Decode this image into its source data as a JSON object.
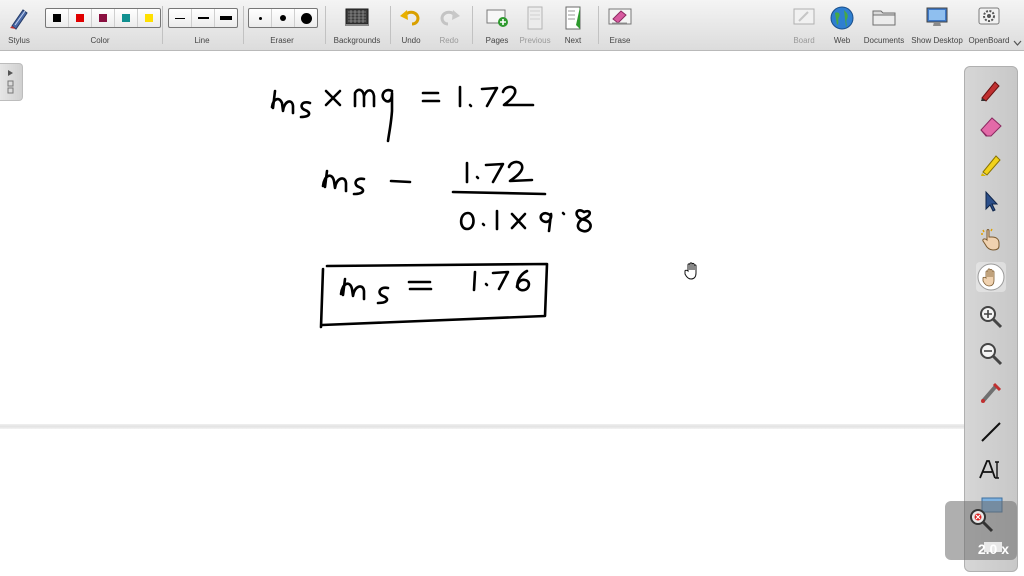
{
  "toolbar": {
    "stylus_label": "Stylus",
    "color_label": "Color",
    "colors": [
      "#000000",
      "#e00000",
      "#8a1040",
      "#119090",
      "#ffe000"
    ],
    "line_label": "Line",
    "eraser_label": "Eraser",
    "backgrounds_label": "Backgrounds",
    "undo_label": "Undo",
    "redo_label": "Redo",
    "pages_label": "Pages",
    "previous_label": "Previous",
    "next_label": "Next",
    "erase_label": "Erase",
    "board_label": "Board",
    "web_label": "Web",
    "documents_label": "Documents",
    "show_desktop_label": "Show Desktop",
    "openboard_label": "OpenBoard"
  },
  "palette": {
    "tools": [
      "pen-tool",
      "eraser-tool",
      "marker-tool",
      "selector-tool",
      "interact-tool",
      "hand-tool",
      "zoom-in-tool",
      "zoom-out-tool",
      "laser-pointer-tool",
      "line-tool",
      "text-tool",
      "capture-tool"
    ],
    "active_tool": "hand-tool"
  },
  "zoom": {
    "level": "2.0 x"
  }
}
